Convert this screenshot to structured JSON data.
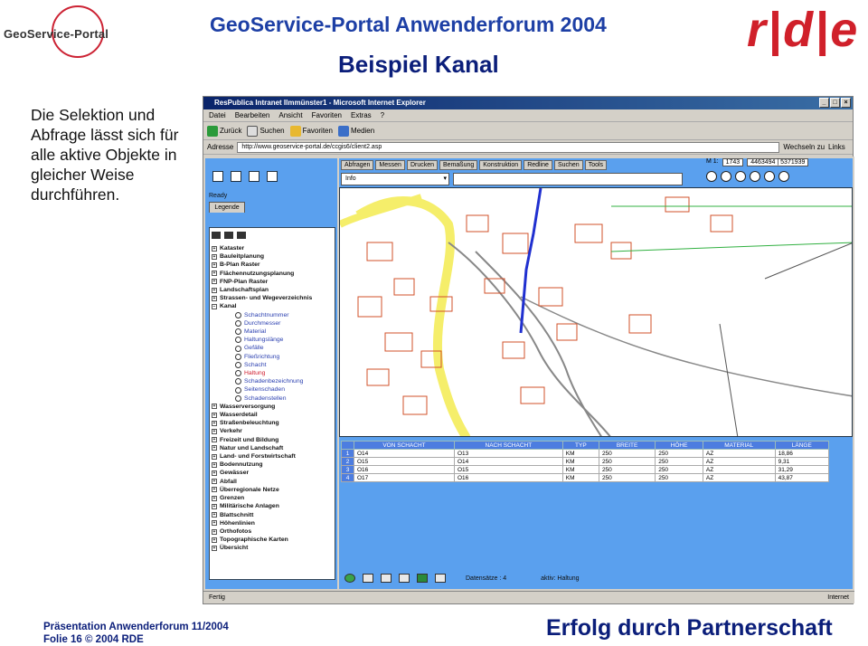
{
  "slide": {
    "logo_left_text": "GeoService-Portal",
    "title": "GeoService-Portal Anwenderforum 2004",
    "subtitle": "Beispiel Kanal",
    "logo_right_text": "r|d|e",
    "side_text": "Die Selektion und Abfrage lässt sich für alle aktive Objekte in gleicher Weise durchführen.",
    "footer_line1": "Präsentation Anwenderforum  11/2004",
    "footer_line2": "Folie 16 © 2004 RDE",
    "footer_slogan": "Erfolg durch Partnerschaft"
  },
  "browser": {
    "window_title": "ResPublica Intranet Ilmmünster1 - Microsoft Internet Explorer",
    "menu": [
      "Datei",
      "Bearbeiten",
      "Ansicht",
      "Favoriten",
      "Extras",
      "?"
    ],
    "toolbar": {
      "back": "Zurück",
      "search": "Suchen",
      "favorites": "Favoriten",
      "media": "Medien"
    },
    "address_label": "Adresse",
    "address_url": "http://www.geoservice-portal.de/ccgis6/client2.asp",
    "go_label": "Wechseln zu",
    "links_label": "Links",
    "status_left": "Fertig",
    "status_right": "Internet"
  },
  "left_panel": {
    "ready_label": "Ready",
    "tab_label": "Legende",
    "layers": [
      "Kataster",
      "Bauleitplanung",
      "B-Plan Raster",
      "Flächennutzungsplanung",
      "FNP-Plan Raster",
      "Landschaftsplan",
      "Strassen- und Wegeverzeichnis",
      "Kanal"
    ],
    "kanal_children": [
      "Schachtnummer",
      "Durchmesser",
      "Material",
      "Haltungslänge",
      "Gefälle",
      "Fließrichtung",
      "Schacht",
      "Haltung",
      "Schadenbezeichnung",
      "Seitenschaden",
      "Schadenstellen"
    ],
    "layers_after": [
      "Wasserversorgung",
      "Wasserdetail",
      "Straßenbeleuchtung",
      "Verkehr",
      "Freizeit und Bildung",
      "Natur und Landschaft",
      "Land- und Forstwirtschaft",
      "Bodennutzung",
      "Gewässer",
      "Abfall",
      "Überregionale Netze",
      "Grenzen",
      "Militärische Anlagen",
      "Blattschnitt",
      "Höhenlinien",
      "Orthofotos",
      "Topographische Karten",
      "Übersicht"
    ]
  },
  "right_panel": {
    "tabs": [
      "Abfragen",
      "Messen",
      "Drucken",
      "Bemaßung",
      "Konstruktion",
      "Redline",
      "Suchen",
      "Tools"
    ],
    "info_select": "Info",
    "scale_label": "M 1:",
    "scale_value": "1743",
    "coords": "4463494 | 5371939",
    "records_label": "Datensätze : 4",
    "active_label": "aktiv: Haltung"
  },
  "table": {
    "headers": [
      "VON SCHACHT",
      "NACH SCHACHT",
      "TYP",
      "BREITE",
      "HÖHE",
      "MATERIAL",
      "LÄNGE"
    ],
    "rows": [
      [
        "1",
        "O14",
        "O13",
        "KM",
        "250",
        "250",
        "AZ",
        "18,86"
      ],
      [
        "2",
        "O15",
        "O14",
        "KM",
        "250",
        "250",
        "AZ",
        "9,31"
      ],
      [
        "3",
        "O16",
        "O15",
        "KM",
        "250",
        "250",
        "AZ",
        "31,29"
      ],
      [
        "4",
        "O17",
        "O16",
        "KM",
        "250",
        "250",
        "AZ",
        "43,87"
      ]
    ]
  },
  "colors": {
    "slide_blue": "#0b1e7a",
    "title_blue": "#1d3fa5",
    "logo_red": "#d0202a",
    "panel_blue": "#5aa0ee",
    "road_yellow": "#f5ee6a",
    "parcel_red": "#d2502a",
    "selection_blue": "#2030d0",
    "green_lines": "#30b040"
  },
  "icons": [
    "globe-logo-icon",
    "back-icon",
    "search-icon",
    "favorites-icon",
    "zoom-in-icon",
    "zoom-out-icon",
    "print-icon",
    "pan-icon"
  ]
}
